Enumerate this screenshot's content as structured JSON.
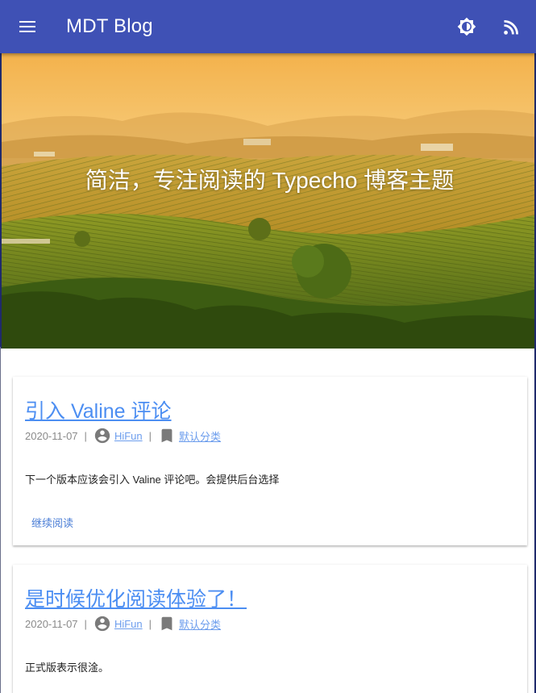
{
  "app": {
    "title": "MDT Blog"
  },
  "toolbar": {
    "menu_icon": "menu-icon",
    "theme_icon": "brightness-icon",
    "rss_icon": "rss-icon"
  },
  "hero": {
    "title": "简洁，专注阅读的 Typecho 博客主题",
    "image": "vineyard-hills-landscape"
  },
  "posts": [
    {
      "title": "引入 Valine 评论",
      "date": "2020-11-07",
      "author": "HiFun",
      "category": "默认分类",
      "excerpt": "下一个版本应该会引入 Valine 评论吧。会提供后台选择",
      "read_more": "继续阅读"
    },
    {
      "title": "是时候优化阅读体验了！",
      "date": "2020-11-07",
      "author": "HiFun",
      "category": "默认分类",
      "excerpt": "正式版表示很淦。"
    }
  ],
  "meta_separator": "|",
  "colors": {
    "appbar": "#3f51b5",
    "link": "#4c8ef2",
    "meta_text": "#8a8a8a"
  }
}
